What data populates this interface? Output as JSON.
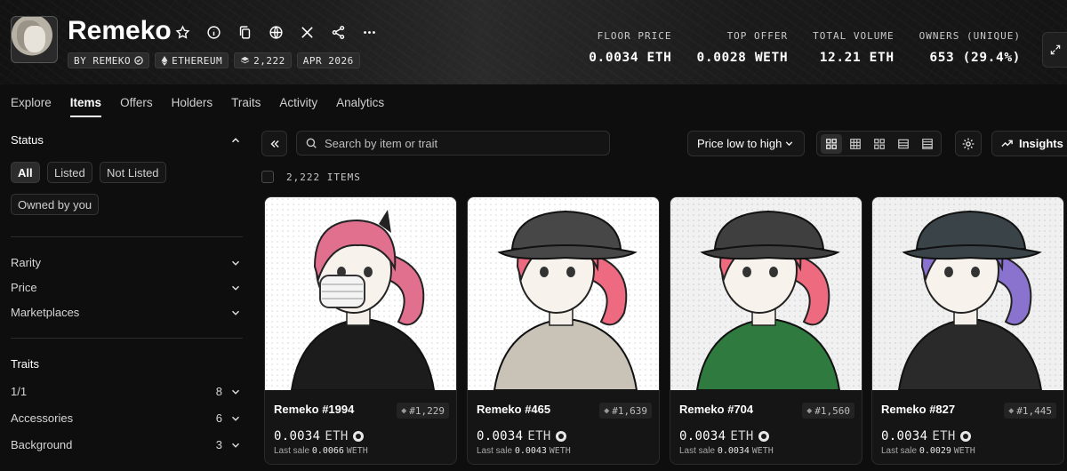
{
  "collection": {
    "name": "Remeko",
    "tags": [
      {
        "label": "BY REMEKO",
        "icon": "check-icon"
      },
      {
        "label": "ETHEREUM",
        "icon": "ethereum-icon"
      },
      {
        "label": "2,222",
        "icon": "layers-icon"
      },
      {
        "label": "APR 2026",
        "icon": ""
      }
    ]
  },
  "stats": [
    {
      "label": "FLOOR PRICE",
      "value": "0.0034 ETH"
    },
    {
      "label": "TOP OFFER",
      "value": "0.0028 WETH"
    },
    {
      "label": "TOTAL VOLUME",
      "value": "12.21 ETH"
    },
    {
      "label": "OWNERS (UNIQUE)",
      "value": "653 (29.4%)"
    }
  ],
  "tabs": [
    "Explore",
    "Items",
    "Offers",
    "Holders",
    "Traits",
    "Activity",
    "Analytics"
  ],
  "active_tab": "Items",
  "sidebar": {
    "status_title": "Status",
    "status_pills": [
      "All",
      "Listed",
      "Not Listed",
      "Owned by you"
    ],
    "filters": [
      "Rarity",
      "Price",
      "Marketplaces"
    ],
    "traits_title": "Traits",
    "traits": [
      {
        "name": "1/1",
        "count": "8"
      },
      {
        "name": "Accessories",
        "count": "6"
      },
      {
        "name": "Background",
        "count": "3"
      }
    ]
  },
  "toolbar": {
    "search_placeholder": "Search by item or trait",
    "sort_label": "Price low to high",
    "insights_label": "Insights",
    "items_count": "2,222 ITEMS"
  },
  "items": [
    {
      "name": "Remeko #1994",
      "rank": "#1,229",
      "price": "0.0034",
      "unit": "ETH",
      "last_label": "Last sale",
      "last_value": "0.0066",
      "last_unit": "WETH",
      "hair": "#e0708e",
      "top": "#1c1c1c",
      "hat": "none",
      "bg": "#ffffff"
    },
    {
      "name": "Remeko #465",
      "rank": "#1,639",
      "price": "0.0034",
      "unit": "ETH",
      "last_label": "Last sale",
      "last_value": "0.0043",
      "last_unit": "WETH",
      "hair": "#ee6a80",
      "top": "#c9c2b6",
      "hat": "#474747",
      "bg": "#ffffff"
    },
    {
      "name": "Remeko #704",
      "rank": "#1,560",
      "price": "0.0034",
      "unit": "ETH",
      "last_label": "Last sale",
      "last_value": "0.0034",
      "last_unit": "WETH",
      "hair": "#ee6a7e",
      "top": "#2f7a3e",
      "hat": "#3f3f3f",
      "bg": "#f1f1f1"
    },
    {
      "name": "Remeko #827",
      "rank": "#1,445",
      "price": "0.0034",
      "unit": "ETH",
      "last_label": "Last sale",
      "last_value": "0.0029",
      "last_unit": "WETH",
      "hair": "#8a72cf",
      "top": "#2a2a2a",
      "hat": "#3a4448",
      "bg": "#f0f0f0"
    }
  ]
}
